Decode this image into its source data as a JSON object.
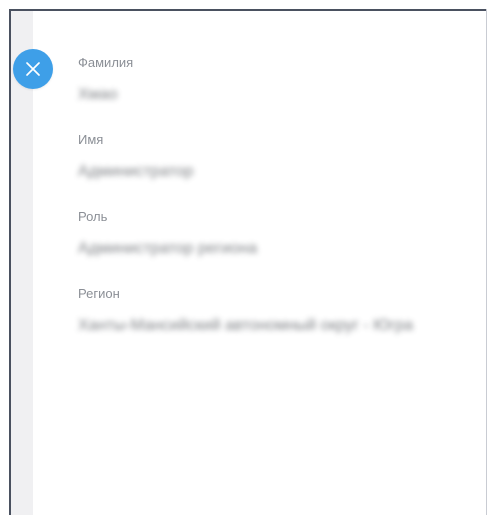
{
  "close_button": {
    "icon": "close-icon",
    "color": "#3e9fe8"
  },
  "profile": {
    "fields": [
      {
        "label": "Фамилия",
        "value": "Хмао"
      },
      {
        "label": "Имя",
        "value": "Администратор"
      },
      {
        "label": "Роль",
        "value": "Администратор региона"
      },
      {
        "label": "Регион",
        "value": "Ханты-Мансийский автономный округ - Югра"
      }
    ]
  }
}
